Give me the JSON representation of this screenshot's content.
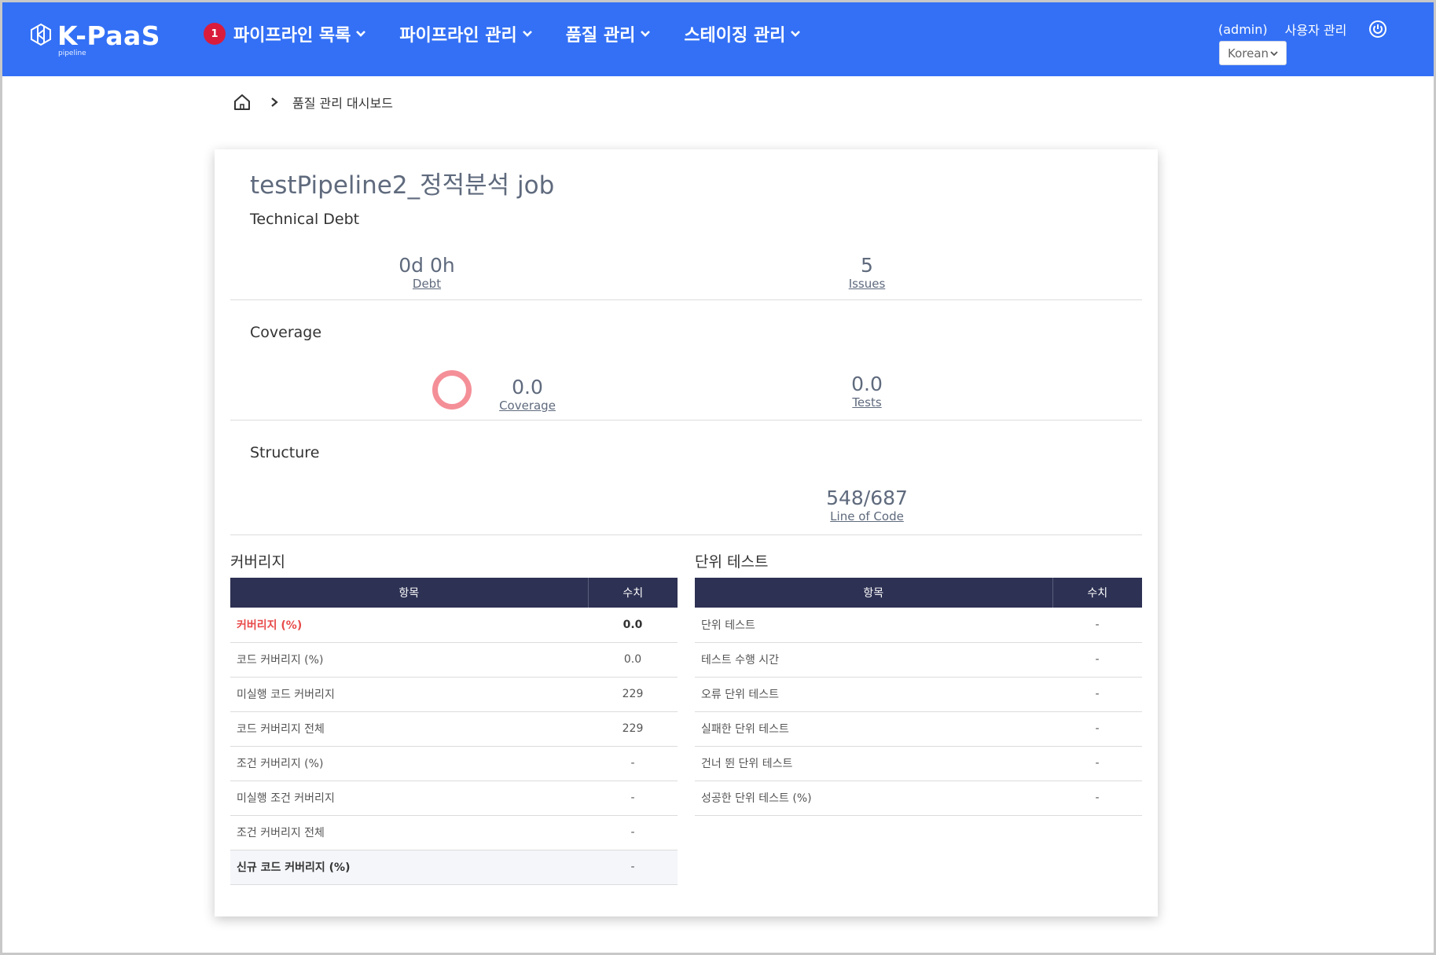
{
  "app": {
    "logo_text": "K-PaaS",
    "logo_sub": "pipeline",
    "brand_color": "#3370f5"
  },
  "nav": {
    "badge_count": "1",
    "items": [
      {
        "label": "파이프라인 목록"
      },
      {
        "label": "파이프라인 관리"
      },
      {
        "label": "품질 관리"
      },
      {
        "label": "스테이징 관리"
      }
    ]
  },
  "user": {
    "name": "(admin)",
    "manage_label": "사용자 관리",
    "language": "Korean"
  },
  "breadcrumb": {
    "current": "품질 관리 대시보드"
  },
  "dashboard": {
    "title": "testPipeline2_정적분석 job",
    "technical_debt": {
      "label": "Technical Debt",
      "debt_value": "0d 0h",
      "debt_label": "Debt",
      "issues_value": "5",
      "issues_label": "Issues"
    },
    "coverage": {
      "label": "Coverage",
      "coverage_value": "0.0",
      "coverage_label": "Coverage",
      "tests_value": "0.0",
      "tests_label": "Tests",
      "ring_color": "#f48f98"
    },
    "structure": {
      "label": "Structure",
      "loc_value": "548/687",
      "loc_label": "Line of Code"
    }
  },
  "coverage_table": {
    "title": "커버리지",
    "headers": [
      "항목",
      "수치"
    ],
    "rows": [
      {
        "item": "커버리지 (%)",
        "value": "0.0"
      },
      {
        "item": "코드 커버리지 (%)",
        "value": "0.0"
      },
      {
        "item": "미실행 코드 커버리지",
        "value": "229"
      },
      {
        "item": "코드 커버리지 전체",
        "value": "229"
      },
      {
        "item": "조건 커버리지 (%)",
        "value": "-"
      },
      {
        "item": "미실행 조건 커버리지",
        "value": "-"
      },
      {
        "item": "조건 커버리지 전체",
        "value": "-"
      },
      {
        "item": "신규 코드 커버리지 (%)",
        "value": "-"
      }
    ]
  },
  "unit_test_table": {
    "title": "단위 테스트",
    "headers": [
      "항목",
      "수치"
    ],
    "rows": [
      {
        "item": "단위 테스트",
        "value": "-"
      },
      {
        "item": "테스트 수행 시간",
        "value": "-"
      },
      {
        "item": "오류 단위 테스트",
        "value": "-"
      },
      {
        "item": "실패한 단위 테스트",
        "value": "-"
      },
      {
        "item": "건너 뛴 단위 테스트",
        "value": "-"
      },
      {
        "item": "성공한 단위 테스트 (%)",
        "value": "-"
      }
    ]
  }
}
